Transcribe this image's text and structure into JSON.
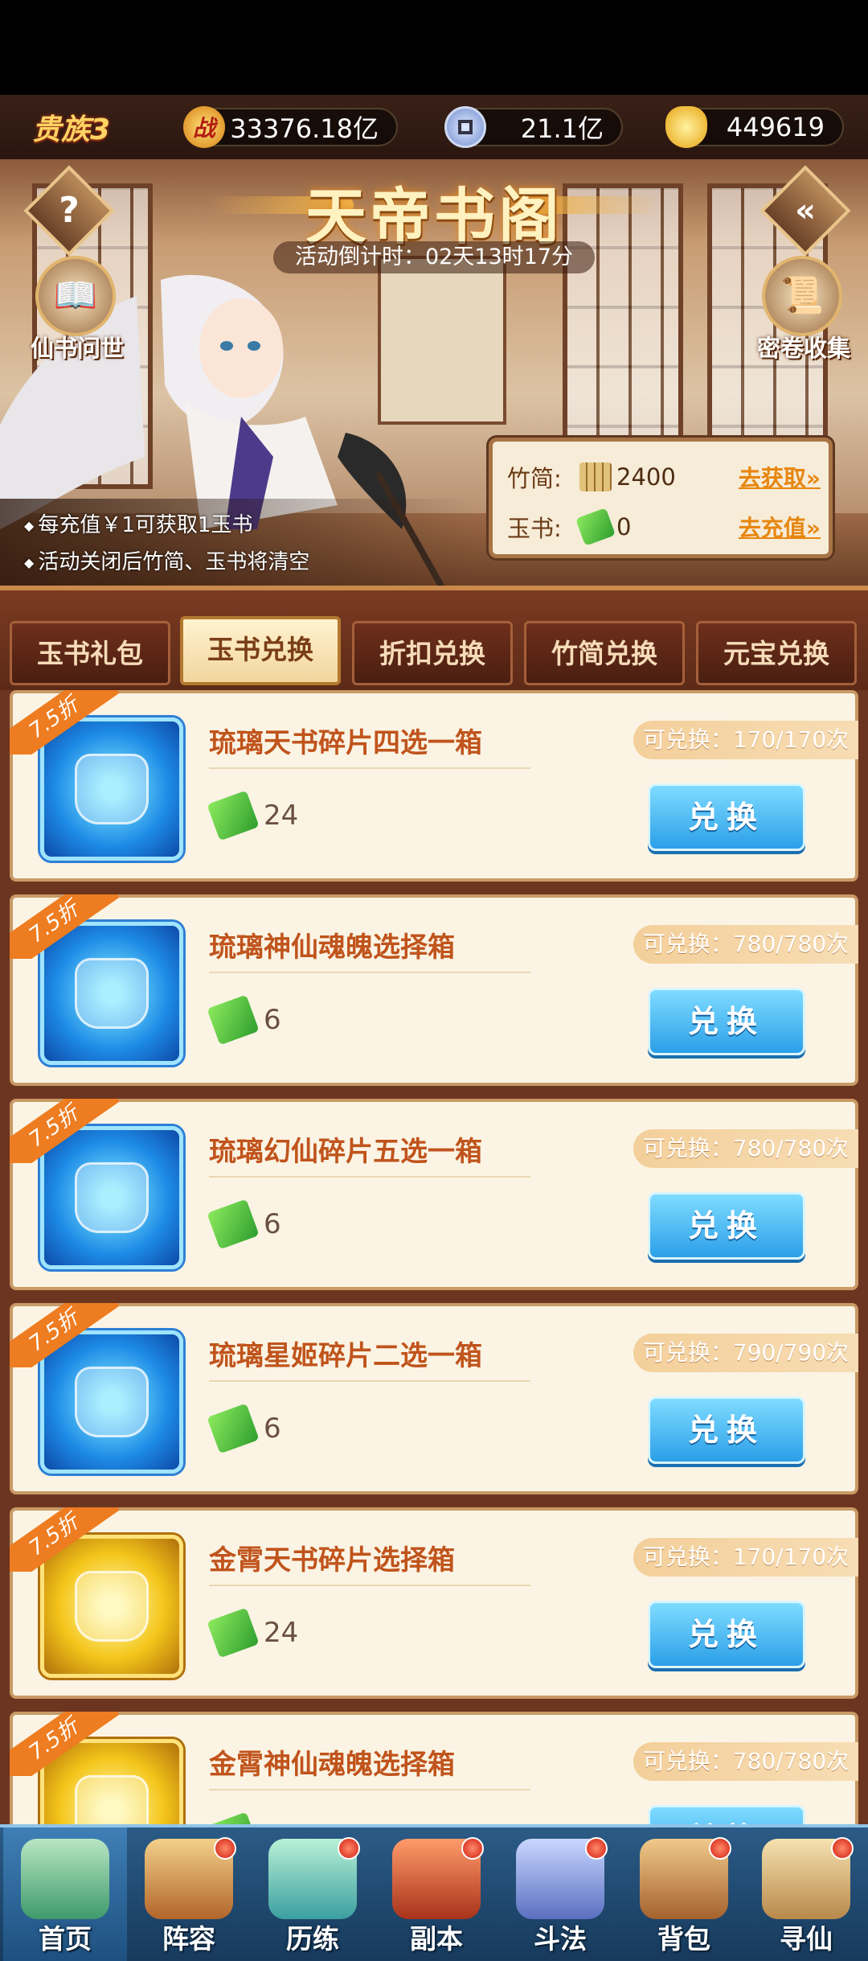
{
  "header": {
    "vip_label": "贵族3",
    "power_icon_text": "战",
    "power_value": "33376.18亿",
    "silver_value": "21.1亿",
    "gold_value": "449619"
  },
  "banner": {
    "title": "天帝书阁",
    "countdown": "活动倒计时：02天13时17分",
    "help_symbol": "?",
    "left_button_label": "仙书问世",
    "right_button_label": "密卷收集",
    "bamboo_label": "竹简:",
    "bamboo_value": "2400",
    "bamboo_link": "去获取",
    "jade_label": "玉书:",
    "jade_value": "0",
    "jade_link": "去充值",
    "notes": [
      "每充值￥1可获取1玉书",
      "活动关闭后竹简、玉书将清空"
    ]
  },
  "tabs": [
    {
      "label": "玉书礼包",
      "active": false
    },
    {
      "label": "玉书兑换",
      "active": true
    },
    {
      "label": "折扣兑换",
      "active": false
    },
    {
      "label": "竹简兑换",
      "active": false
    },
    {
      "label": "元宝兑换",
      "active": false
    }
  ],
  "items": [
    {
      "discount": "7.5折",
      "name": "琉璃天书碎片四选一箱",
      "cost": "24",
      "limit": "可兑换：170/170次",
      "button": "兑换",
      "theme": "blue"
    },
    {
      "discount": "7.5折",
      "name": "琉璃神仙魂魄选择箱",
      "cost": "6",
      "limit": "可兑换：780/780次",
      "button": "兑换",
      "theme": "blue"
    },
    {
      "discount": "7.5折",
      "name": "琉璃幻仙碎片五选一箱",
      "cost": "6",
      "limit": "可兑换：780/780次",
      "button": "兑换",
      "theme": "blue"
    },
    {
      "discount": "7.5折",
      "name": "琉璃星姬碎片二选一箱",
      "cost": "6",
      "limit": "可兑换：790/790次",
      "button": "兑换",
      "theme": "blue"
    },
    {
      "discount": "7.5折",
      "name": "金霄天书碎片选择箱",
      "cost": "24",
      "limit": "可兑换：170/170次",
      "button": "兑换",
      "theme": "gold"
    },
    {
      "discount": "7.5折",
      "name": "金霄神仙魂魄选择箱",
      "cost": "",
      "limit": "可兑换：780/780次",
      "button": "兑换",
      "theme": "gold"
    }
  ],
  "bottom_nav": [
    {
      "label": "首页",
      "dot": false,
      "active": true
    },
    {
      "label": "阵容",
      "dot": true,
      "active": false
    },
    {
      "label": "历练",
      "dot": true,
      "active": false
    },
    {
      "label": "副本",
      "dot": true,
      "active": false
    },
    {
      "label": "斗法",
      "dot": true,
      "active": false
    },
    {
      "label": "背包",
      "dot": true,
      "active": false
    },
    {
      "label": "寻仙",
      "dot": true,
      "active": false
    }
  ],
  "colors": {
    "accent_orange": "#ee7c20",
    "button_blue": "#2b9fe8",
    "item_name": "#c0541c",
    "tab_bar": "#6c3520"
  }
}
